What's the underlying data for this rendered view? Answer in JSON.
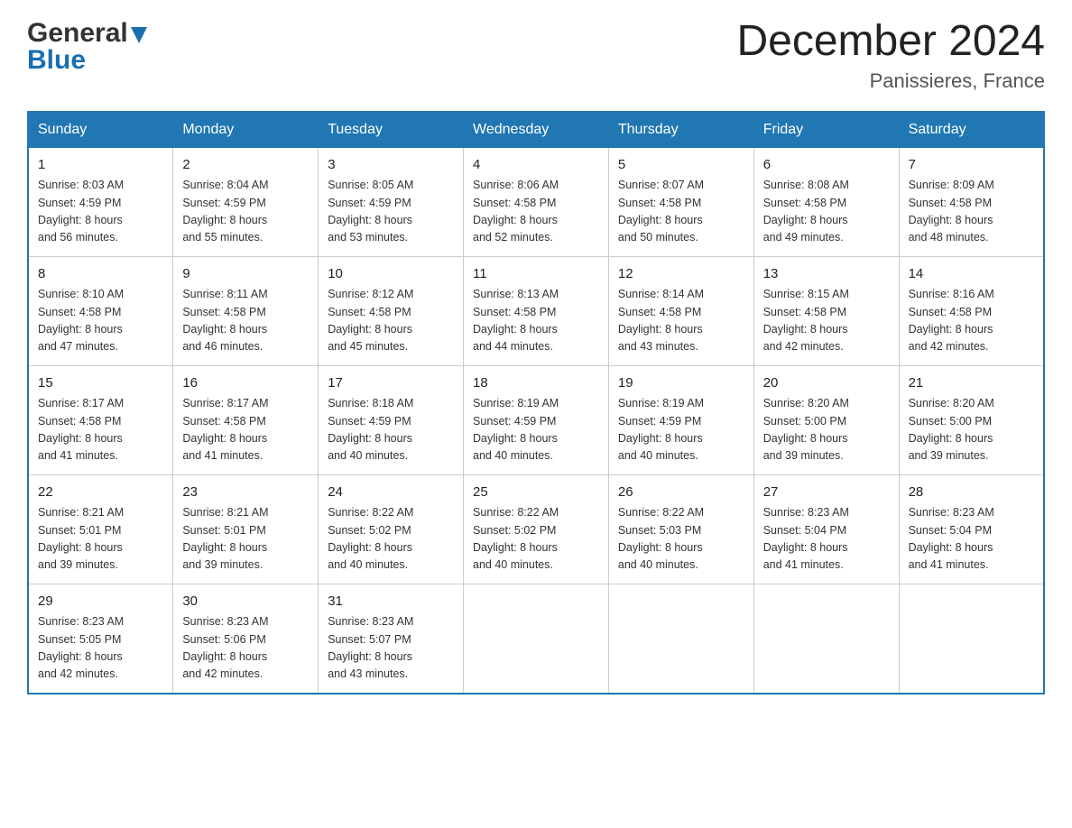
{
  "header": {
    "logo_general": "General",
    "logo_blue": "Blue",
    "title": "December 2024",
    "location": "Panissieres, France"
  },
  "weekdays": [
    "Sunday",
    "Monday",
    "Tuesday",
    "Wednesday",
    "Thursday",
    "Friday",
    "Saturday"
  ],
  "weeks": [
    [
      {
        "day": "1",
        "sunrise": "8:03 AM",
        "sunset": "4:59 PM",
        "daylight": "8 hours and 56 minutes."
      },
      {
        "day": "2",
        "sunrise": "8:04 AM",
        "sunset": "4:59 PM",
        "daylight": "8 hours and 55 minutes."
      },
      {
        "day": "3",
        "sunrise": "8:05 AM",
        "sunset": "4:59 PM",
        "daylight": "8 hours and 53 minutes."
      },
      {
        "day": "4",
        "sunrise": "8:06 AM",
        "sunset": "4:58 PM",
        "daylight": "8 hours and 52 minutes."
      },
      {
        "day": "5",
        "sunrise": "8:07 AM",
        "sunset": "4:58 PM",
        "daylight": "8 hours and 50 minutes."
      },
      {
        "day": "6",
        "sunrise": "8:08 AM",
        "sunset": "4:58 PM",
        "daylight": "8 hours and 49 minutes."
      },
      {
        "day": "7",
        "sunrise": "8:09 AM",
        "sunset": "4:58 PM",
        "daylight": "8 hours and 48 minutes."
      }
    ],
    [
      {
        "day": "8",
        "sunrise": "8:10 AM",
        "sunset": "4:58 PM",
        "daylight": "8 hours and 47 minutes."
      },
      {
        "day": "9",
        "sunrise": "8:11 AM",
        "sunset": "4:58 PM",
        "daylight": "8 hours and 46 minutes."
      },
      {
        "day": "10",
        "sunrise": "8:12 AM",
        "sunset": "4:58 PM",
        "daylight": "8 hours and 45 minutes."
      },
      {
        "day": "11",
        "sunrise": "8:13 AM",
        "sunset": "4:58 PM",
        "daylight": "8 hours and 44 minutes."
      },
      {
        "day": "12",
        "sunrise": "8:14 AM",
        "sunset": "4:58 PM",
        "daylight": "8 hours and 43 minutes."
      },
      {
        "day": "13",
        "sunrise": "8:15 AM",
        "sunset": "4:58 PM",
        "daylight": "8 hours and 42 minutes."
      },
      {
        "day": "14",
        "sunrise": "8:16 AM",
        "sunset": "4:58 PM",
        "daylight": "8 hours and 42 minutes."
      }
    ],
    [
      {
        "day": "15",
        "sunrise": "8:17 AM",
        "sunset": "4:58 PM",
        "daylight": "8 hours and 41 minutes."
      },
      {
        "day": "16",
        "sunrise": "8:17 AM",
        "sunset": "4:58 PM",
        "daylight": "8 hours and 41 minutes."
      },
      {
        "day": "17",
        "sunrise": "8:18 AM",
        "sunset": "4:59 PM",
        "daylight": "8 hours and 40 minutes."
      },
      {
        "day": "18",
        "sunrise": "8:19 AM",
        "sunset": "4:59 PM",
        "daylight": "8 hours and 40 minutes."
      },
      {
        "day": "19",
        "sunrise": "8:19 AM",
        "sunset": "4:59 PM",
        "daylight": "8 hours and 40 minutes."
      },
      {
        "day": "20",
        "sunrise": "8:20 AM",
        "sunset": "5:00 PM",
        "daylight": "8 hours and 39 minutes."
      },
      {
        "day": "21",
        "sunrise": "8:20 AM",
        "sunset": "5:00 PM",
        "daylight": "8 hours and 39 minutes."
      }
    ],
    [
      {
        "day": "22",
        "sunrise": "8:21 AM",
        "sunset": "5:01 PM",
        "daylight": "8 hours and 39 minutes."
      },
      {
        "day": "23",
        "sunrise": "8:21 AM",
        "sunset": "5:01 PM",
        "daylight": "8 hours and 39 minutes."
      },
      {
        "day": "24",
        "sunrise": "8:22 AM",
        "sunset": "5:02 PM",
        "daylight": "8 hours and 40 minutes."
      },
      {
        "day": "25",
        "sunrise": "8:22 AM",
        "sunset": "5:02 PM",
        "daylight": "8 hours and 40 minutes."
      },
      {
        "day": "26",
        "sunrise": "8:22 AM",
        "sunset": "5:03 PM",
        "daylight": "8 hours and 40 minutes."
      },
      {
        "day": "27",
        "sunrise": "8:23 AM",
        "sunset": "5:04 PM",
        "daylight": "8 hours and 41 minutes."
      },
      {
        "day": "28",
        "sunrise": "8:23 AM",
        "sunset": "5:04 PM",
        "daylight": "8 hours and 41 minutes."
      }
    ],
    [
      {
        "day": "29",
        "sunrise": "8:23 AM",
        "sunset": "5:05 PM",
        "daylight": "8 hours and 42 minutes."
      },
      {
        "day": "30",
        "sunrise": "8:23 AM",
        "sunset": "5:06 PM",
        "daylight": "8 hours and 42 minutes."
      },
      {
        "day": "31",
        "sunrise": "8:23 AM",
        "sunset": "5:07 PM",
        "daylight": "8 hours and 43 minutes."
      },
      null,
      null,
      null,
      null
    ]
  ]
}
